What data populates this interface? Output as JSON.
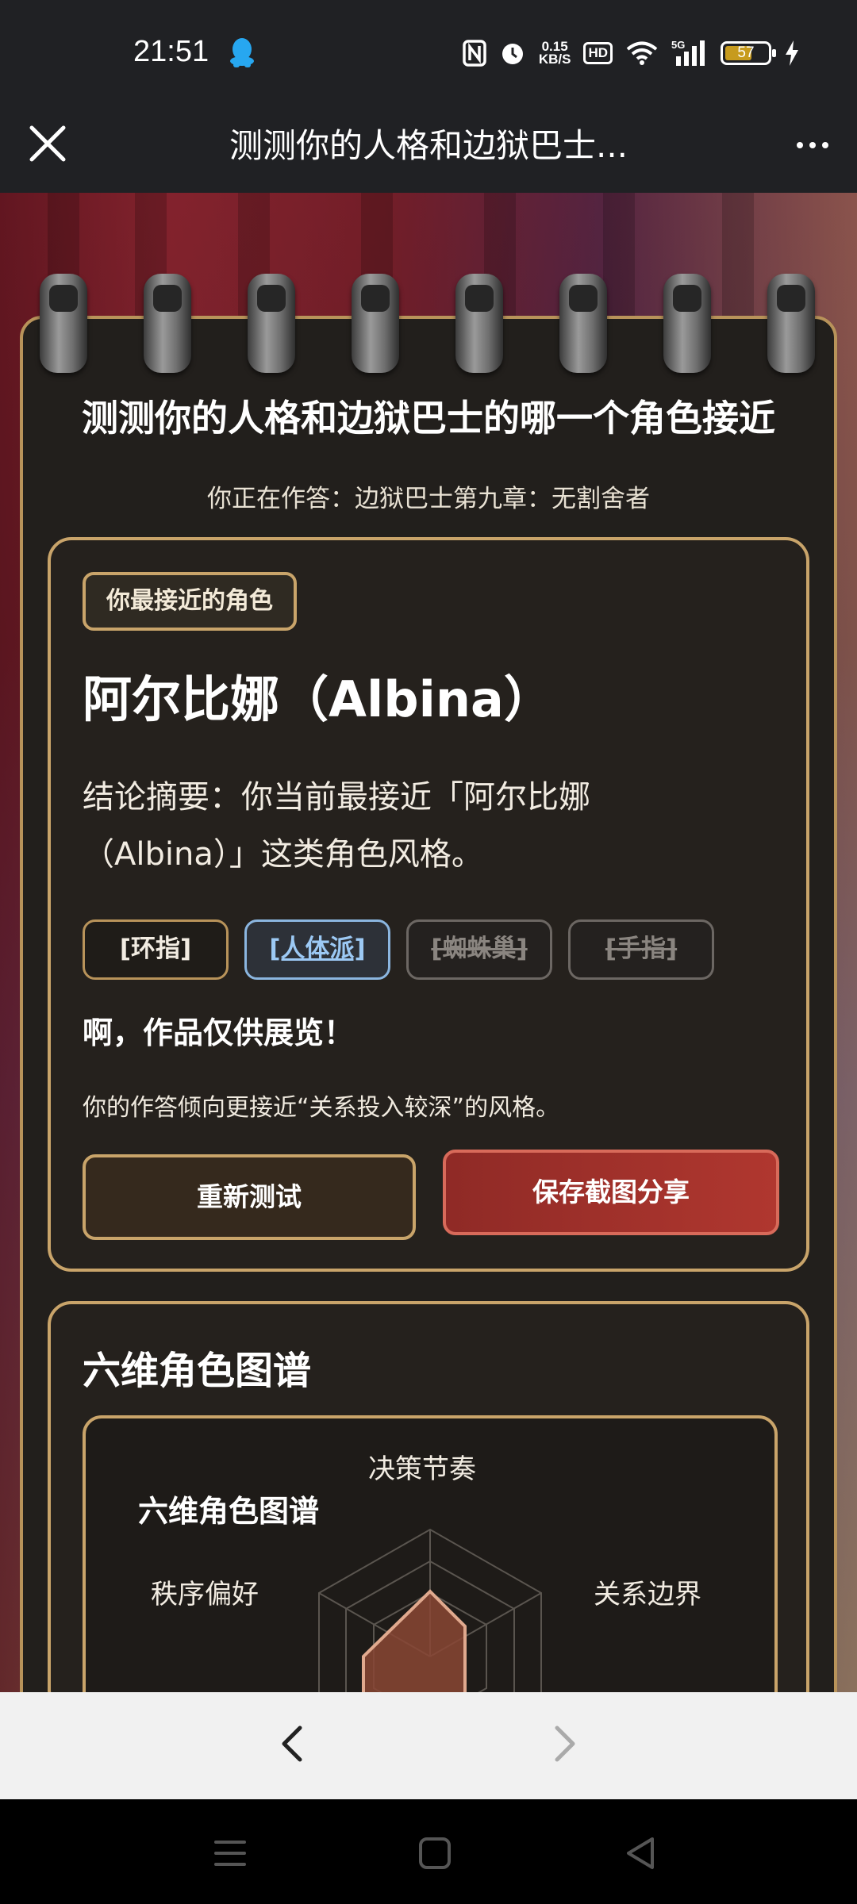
{
  "status_bar": {
    "time": "21:51",
    "net_speed_value": "0.15",
    "net_speed_unit": "KB/S",
    "hd_label": "HD",
    "network_label": "5G",
    "battery_level": "57",
    "icons": [
      "qq-icon",
      "nfc-icon",
      "alarm-icon",
      "wifi-icon",
      "signal-icon",
      "battery-icon",
      "charging-icon"
    ]
  },
  "header": {
    "title": "测测你的人格和边狱巴士...",
    "icons": [
      "close-icon",
      "more-icon"
    ]
  },
  "page": {
    "title": "测测你的人格和边狱巴士的哪一个角色接近",
    "subtitle": "你正在作答：边狱巴士第九章：无割舍者"
  },
  "result": {
    "badge": "你最接近的角色",
    "name": "阿尔比娜（Albina）",
    "summary": "结论摘要：你当前最接近「阿尔比娜（Albina）」这类角色风格。",
    "tags": [
      {
        "label": "[环指]",
        "state": "normal"
      },
      {
        "label": "[人体派]",
        "state": "active"
      },
      {
        "label": "[蜘蛛巢]",
        "state": "struck"
      },
      {
        "label": "[手指]",
        "state": "struck"
      }
    ],
    "exclaim": "啊，作品仅供展览！",
    "tendency": "你的作答倾向更接近“关系投入较深”的风格。",
    "retry_button": "重新测试",
    "save_button": "保存截图分享"
  },
  "radar": {
    "section_title": "六维角色图谱",
    "chart_title": "六维角色图谱",
    "axis_labels": {
      "top": "决策节奏",
      "upper_left": "秩序偏好",
      "upper_right": "关系边界"
    },
    "colors": {
      "fill": "#8a4634",
      "stroke": "#e0a98e",
      "grid": "#5a554f"
    }
  },
  "bottom_nav": {
    "icons": [
      "back-icon",
      "forward-icon"
    ]
  },
  "system_nav": {
    "icons": [
      "menu-icon",
      "home-icon",
      "back-triangle-icon"
    ]
  }
}
